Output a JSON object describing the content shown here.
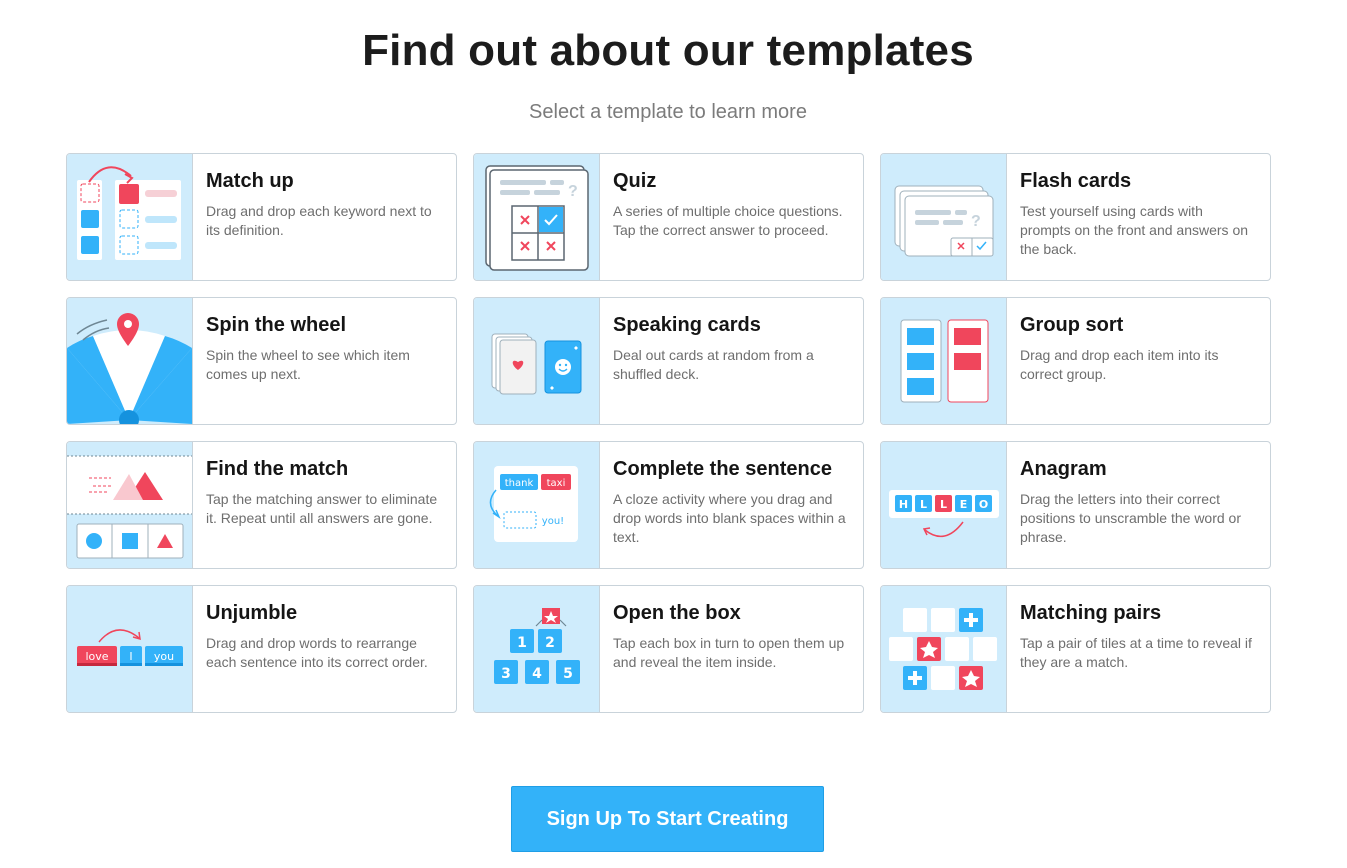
{
  "header": {
    "title": "Find out about our templates",
    "subtitle": "Select a template to learn more"
  },
  "templates": [
    {
      "title": "Match up",
      "description": "Drag and drop each keyword next to its definition.",
      "icon": "match-up-icon"
    },
    {
      "title": "Quiz",
      "description": "A series of multiple choice questions. Tap the correct answer to proceed.",
      "icon": "quiz-icon"
    },
    {
      "title": "Flash cards",
      "description": "Test yourself using cards with prompts on the front and answers on the back.",
      "icon": "flash-cards-icon"
    },
    {
      "title": "Spin the wheel",
      "description": "Spin the wheel to see which item comes up next.",
      "icon": "spin-wheel-icon"
    },
    {
      "title": "Speaking cards",
      "description": "Deal out cards at random from a shuffled deck.",
      "icon": "speaking-cards-icon"
    },
    {
      "title": "Group sort",
      "description": "Drag and drop each item into its correct group.",
      "icon": "group-sort-icon"
    },
    {
      "title": "Find the match",
      "description": "Tap the matching answer to eliminate it. Repeat until all answers are gone.",
      "icon": "find-match-icon"
    },
    {
      "title": "Complete the sentence",
      "description": "A cloze activity where you drag and drop words into blank spaces within a text.",
      "icon": "complete-sentence-icon"
    },
    {
      "title": "Anagram",
      "description": "Drag the letters into their correct positions to unscramble the word or phrase.",
      "icon": "anagram-icon"
    },
    {
      "title": "Unjumble",
      "description": "Drag and drop words to rearrange each sentence into its correct order.",
      "icon": "unjumble-icon"
    },
    {
      "title": "Open the box",
      "description": "Tap each box in turn to open them up and reveal the item inside.",
      "icon": "open-box-icon"
    },
    {
      "title": "Matching pairs",
      "description": "Tap a pair of tiles at a time to reveal if they are a match.",
      "icon": "matching-pairs-icon"
    }
  ],
  "thumb_text": {
    "complete_sentence_words": [
      "thank",
      "taxi"
    ],
    "complete_sentence_blank": "you!",
    "anagram_letters": [
      "H",
      "L",
      "L",
      "E",
      "O"
    ],
    "unjumble_words": [
      "love",
      "I",
      "you"
    ],
    "open_box_numbers": [
      "1",
      "2",
      "3",
      "4",
      "5"
    ]
  },
  "cta": {
    "label": "Sign Up To Start Creating"
  },
  "colors": {
    "blue": "#33b2f9",
    "red": "#f0465c",
    "thumb_bg": "#cfecfc",
    "border": "#c9d3da"
  }
}
